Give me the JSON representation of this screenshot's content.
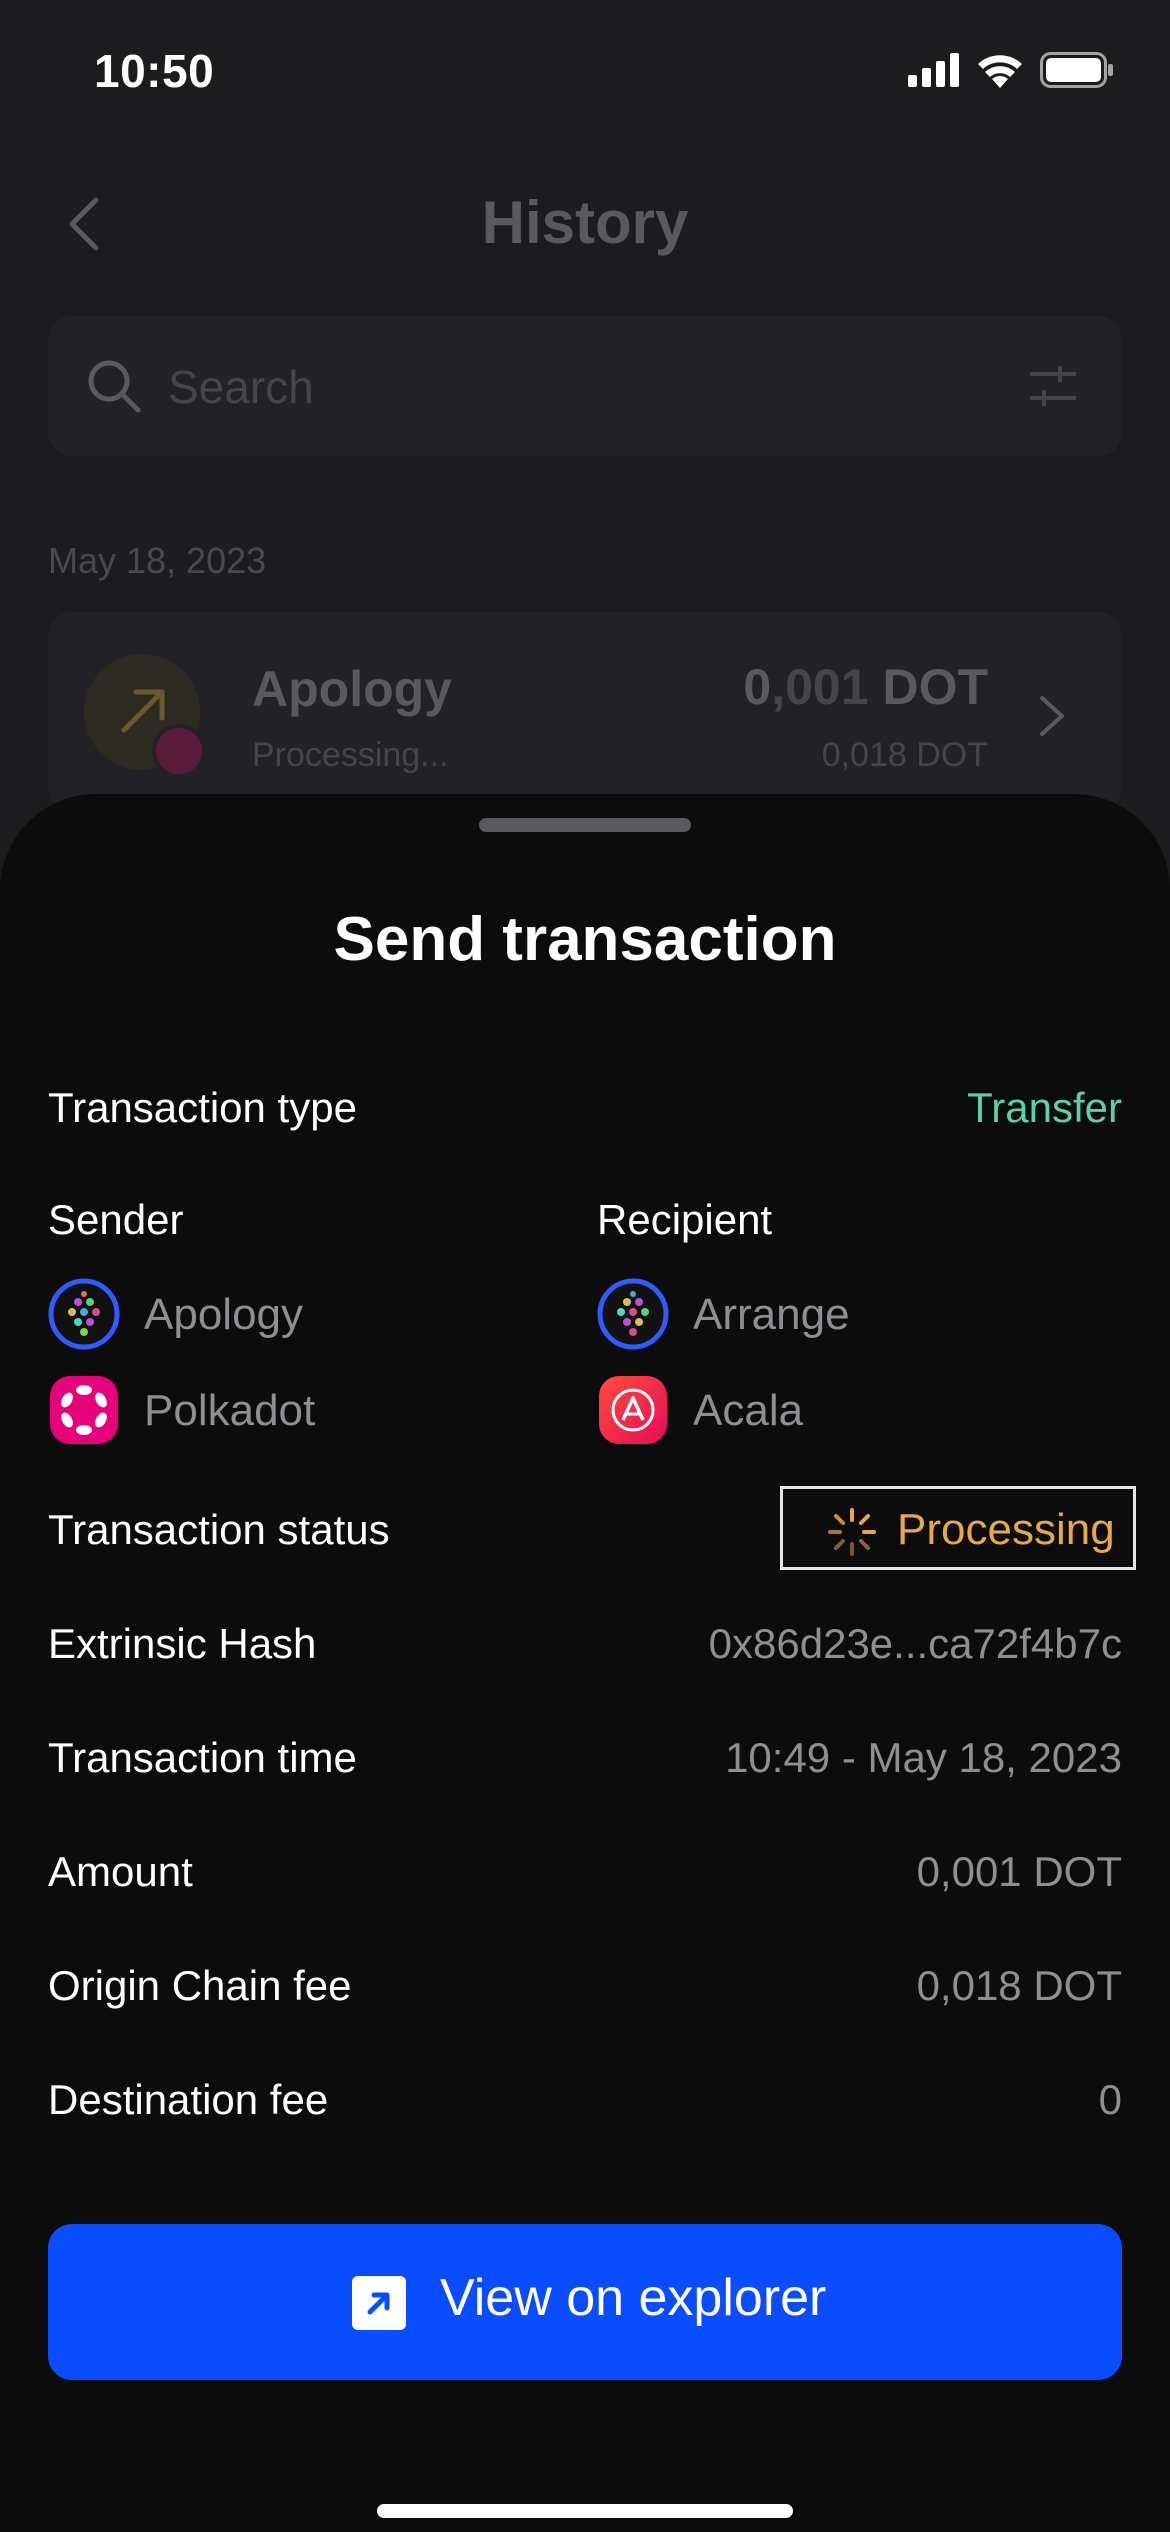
{
  "status_bar": {
    "time": "10:50"
  },
  "background": {
    "title": "History",
    "search_placeholder": "Search",
    "date_header": "May 18, 2023",
    "item": {
      "name": "Apology",
      "status": "Processing...",
      "amount_main": "0",
      "amount_decimals": ",001",
      "amount_unit": " DOT",
      "fee": "0,018 DOT"
    }
  },
  "sheet": {
    "title": "Send transaction",
    "transaction_type": {
      "label": "Transaction type",
      "value": "Transfer"
    },
    "sender": {
      "label": "Sender",
      "account": "Apology",
      "chain": "Polkadot"
    },
    "recipient": {
      "label": "Recipient",
      "account": "Arrange",
      "chain": "Acala"
    },
    "status": {
      "label": "Transaction status",
      "value": "Processing"
    },
    "hash": {
      "label": "Extrinsic Hash",
      "value": "0x86d23e...ca72f4b7c"
    },
    "time": {
      "label": "Transaction time",
      "value": "10:49 - May 18, 2023"
    },
    "amount": {
      "label": "Amount",
      "value": "0,001 DOT"
    },
    "origin_fee": {
      "label": "Origin Chain fee",
      "value": "0,018 DOT"
    },
    "destination_fee": {
      "label": "Destination fee",
      "value": "0"
    },
    "button_label": "View on explorer"
  },
  "colors": {
    "accent_blue": "#0a4cff",
    "transfer_green": "#5ad1a8",
    "processing_orange": "#e7a845",
    "polkadot_pink": "#e6007a"
  }
}
